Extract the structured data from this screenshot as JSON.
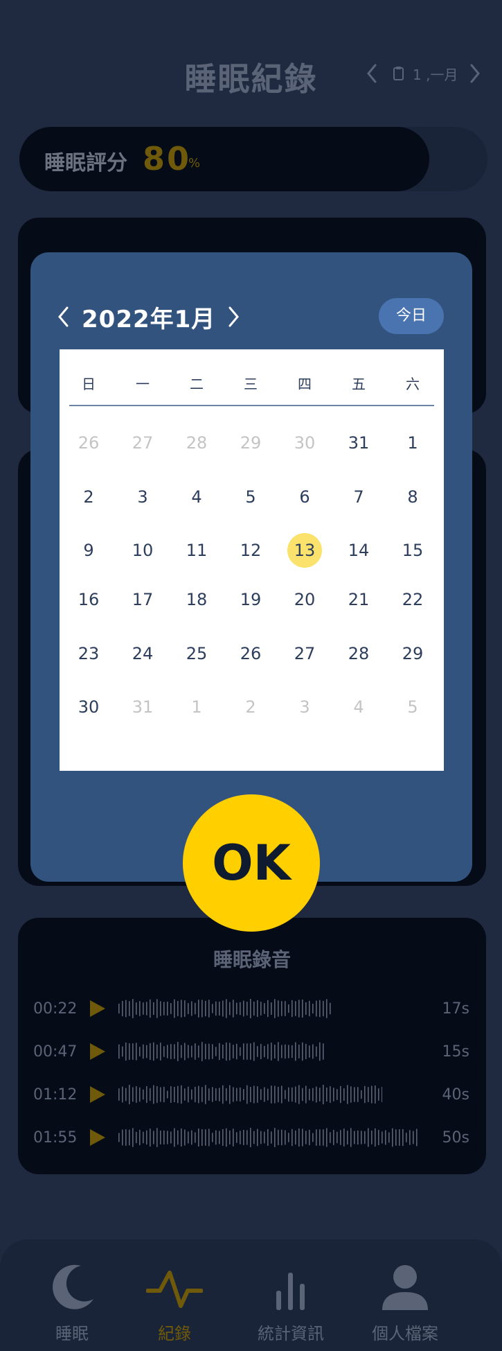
{
  "header": {
    "title": "睡眠紀錄",
    "date_label": "1 ,一月"
  },
  "score": {
    "label": "睡眠評分",
    "value": "80",
    "unit": "%",
    "fraction": 0.8
  },
  "recordings": {
    "title": "睡眠錄音",
    "items": [
      {
        "time": "00:22",
        "duration": "17s"
      },
      {
        "time": "00:47",
        "duration": "15s"
      },
      {
        "time": "01:12",
        "duration": "40s"
      },
      {
        "time": "01:55",
        "duration": "50s"
      }
    ]
  },
  "nav": [
    {
      "label": "睡眠",
      "icon": "moon-icon"
    },
    {
      "label": "紀錄",
      "icon": "pulse-icon",
      "active": true
    },
    {
      "label": "統計資訊",
      "icon": "bar-chart-icon"
    },
    {
      "label": "個人檔案",
      "icon": "user-icon"
    }
  ],
  "calendar": {
    "month_label": "2022年1月",
    "today_label": "今日",
    "weekdays": [
      "日",
      "一",
      "二",
      "三",
      "四",
      "五",
      "六"
    ],
    "weeks": [
      [
        {
          "d": "26",
          "m": true
        },
        {
          "d": "27",
          "m": true
        },
        {
          "d": "28",
          "m": true
        },
        {
          "d": "29",
          "m": true
        },
        {
          "d": "30",
          "m": true
        },
        {
          "d": "31"
        },
        {
          "d": "1"
        }
      ],
      [
        {
          "d": "2"
        },
        {
          "d": "3"
        },
        {
          "d": "4"
        },
        {
          "d": "5"
        },
        {
          "d": "6"
        },
        {
          "d": "7"
        },
        {
          "d": "8"
        }
      ],
      [
        {
          "d": "9"
        },
        {
          "d": "10"
        },
        {
          "d": "11"
        },
        {
          "d": "12"
        },
        {
          "d": "13",
          "s": true
        },
        {
          "d": "14"
        },
        {
          "d": "15"
        }
      ],
      [
        {
          "d": "16"
        },
        {
          "d": "17"
        },
        {
          "d": "18"
        },
        {
          "d": "19"
        },
        {
          "d": "20"
        },
        {
          "d": "21"
        },
        {
          "d": "22"
        }
      ],
      [
        {
          "d": "23"
        },
        {
          "d": "24"
        },
        {
          "d": "25"
        },
        {
          "d": "26"
        },
        {
          "d": "27"
        },
        {
          "d": "28"
        },
        {
          "d": "29"
        }
      ],
      [
        {
          "d": "30"
        },
        {
          "d": "31",
          "m": true
        },
        {
          "d": "1",
          "m": true
        },
        {
          "d": "2",
          "m": true
        },
        {
          "d": "3",
          "m": true
        },
        {
          "d": "4",
          "m": true
        },
        {
          "d": "5",
          "m": true
        }
      ]
    ],
    "selected": "13",
    "ok_label": "OK"
  },
  "colors": {
    "accent": "#ffcf00",
    "selected_day": "#fbe26c",
    "modal": "#33537f",
    "background": "#1f2a41"
  }
}
